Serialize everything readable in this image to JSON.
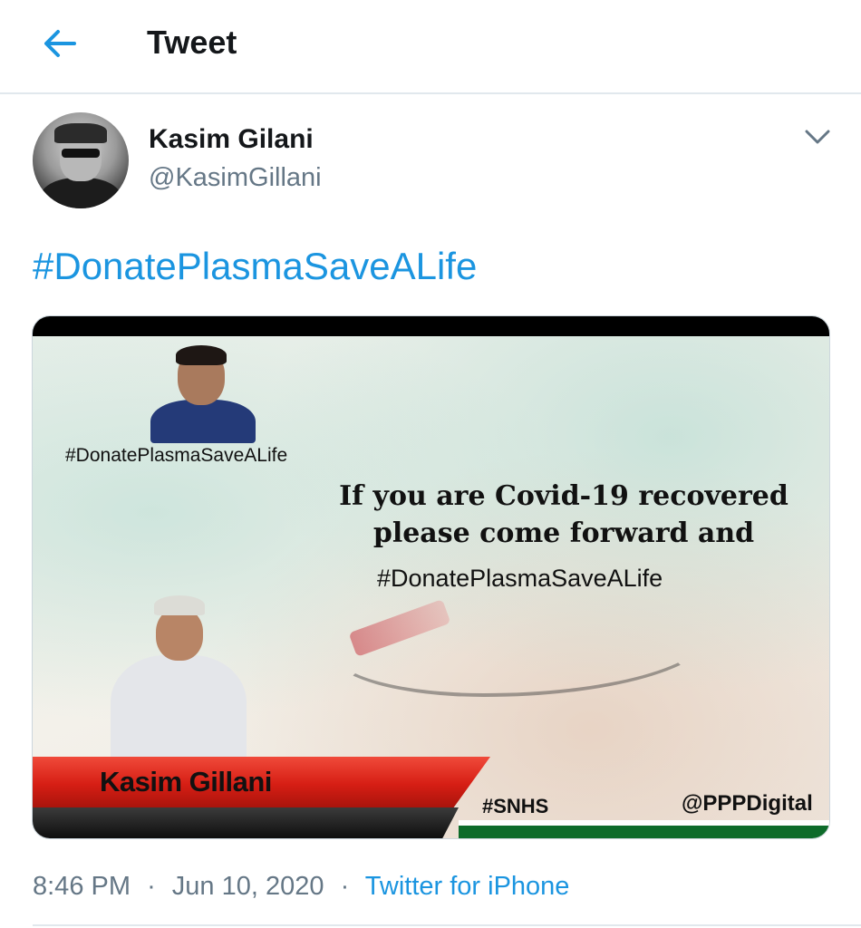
{
  "header": {
    "title": "Tweet",
    "back_icon": "arrow-left-icon"
  },
  "tweet": {
    "author": {
      "display_name": "Kasim Gilani",
      "handle": "@KasimGillani",
      "menu_icon": "chevron-down-icon"
    },
    "hashtag": "#DonatePlasmaSaveALife",
    "media": {
      "top_hashtag": "#DonatePlasmaSaveALife",
      "message_line1": "If you are Covid-19 recovered",
      "message_line2": "please come forward and",
      "middle_hashtag": "#DonatePlasmaSaveALife",
      "banner_name": "Kasim Gillani",
      "tag_snhs": "#SNHS",
      "tag_ppp": "@PPPDigital"
    },
    "time": "8:46 PM",
    "date": "Jun 10, 2020",
    "separator": "·",
    "source": "Twitter for iPhone"
  },
  "colors": {
    "link_blue": "#1b95e0",
    "secondary_text": "#657786",
    "primary_text": "#14171a",
    "banner_red": "#d61e14",
    "flag_green": "#0d6b2a"
  }
}
